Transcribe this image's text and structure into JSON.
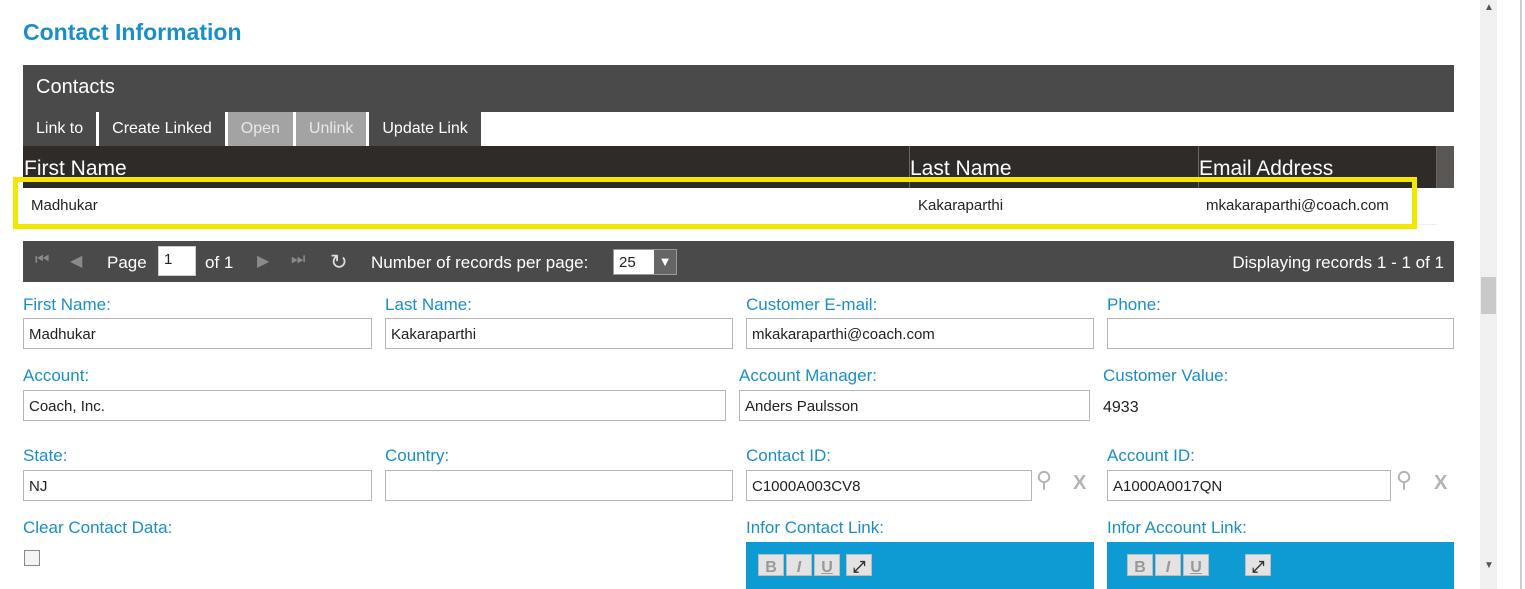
{
  "section_title": "Contact Information",
  "panel": {
    "title": "Contacts",
    "toolbar": [
      {
        "label": "Link to",
        "enabled": true
      },
      {
        "label": "Create Linked",
        "enabled": true
      },
      {
        "label": "Open",
        "enabled": false
      },
      {
        "label": "Unlink",
        "enabled": false
      },
      {
        "label": "Update Link",
        "enabled": true
      }
    ],
    "columns": [
      "First Name",
      "Last Name",
      "Email Address"
    ],
    "rows": [
      {
        "first": "Madhukar",
        "last": "Kakaraparthi",
        "email": "mkakaraparthi@coach.com"
      }
    ],
    "pager": {
      "page_label": "Page",
      "page_value": "1",
      "of_label": "of 1",
      "per_page_label": "Number of records per page:",
      "per_page_value": "25",
      "display_text": "Displaying records 1 - 1 of 1"
    }
  },
  "form": {
    "first_name": {
      "label": "First Name:",
      "value": "Madhukar"
    },
    "last_name": {
      "label": "Last Name:",
      "value": "Kakaraparthi"
    },
    "customer_email": {
      "label": "Customer E-mail:",
      "value": "mkakaraparthi@coach.com"
    },
    "phone": {
      "label": "Phone:",
      "value": ""
    },
    "account": {
      "label": "Account:",
      "value": "Coach, Inc."
    },
    "account_manager": {
      "label": "Account Manager:",
      "value": "Anders Paulsson"
    },
    "customer_value": {
      "label": "Customer Value:",
      "value": "4933"
    },
    "state": {
      "label": "State:",
      "value": "NJ"
    },
    "country": {
      "label": "Country:",
      "value": ""
    },
    "contact_id": {
      "label": "Contact ID:",
      "value": "C1000A003CV8"
    },
    "account_id": {
      "label": "Account ID:",
      "value": "A1000A0017QN"
    },
    "clear_contact_data": {
      "label": "Clear Contact Data:",
      "checked": false
    },
    "infor_contact_link": {
      "label": "Infor Contact Link:"
    },
    "infor_account_link": {
      "label": "Infor Account Link:"
    },
    "rte_buttons": [
      "B",
      "I",
      "U"
    ]
  },
  "colors": {
    "accent": "#1a8ec8",
    "header_bg": "#4a4a4a",
    "grid_header_bg": "#2f2b29",
    "highlight": "#f5e800",
    "rte_bar": "#0e9bd3"
  }
}
